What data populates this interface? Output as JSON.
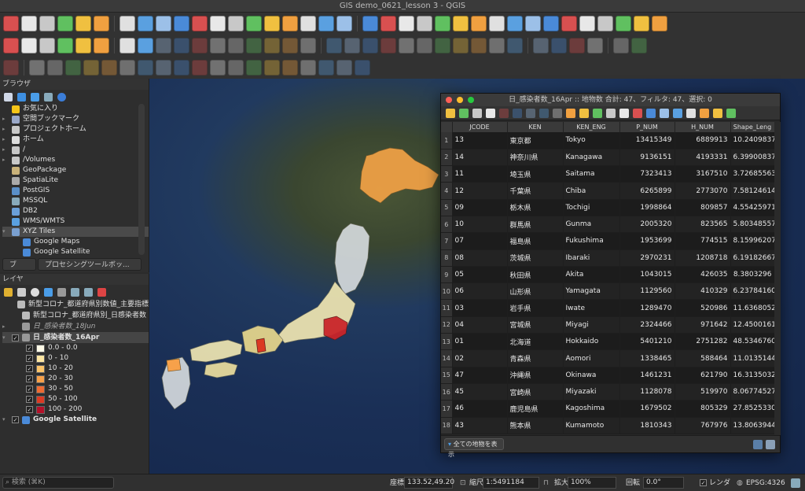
{
  "window": {
    "title": "GIS demo_0621_lesson 3 - QGIS"
  },
  "colors": {
    "accent": "#f0a040",
    "selection": "#4a4a4a",
    "close": "#ff5f56",
    "minimize": "#ffbd2e",
    "zoom": "#27c93f"
  },
  "browser": {
    "title": "ブラウザ",
    "items": [
      {
        "label": "お気に入り",
        "icon": "star-icon"
      },
      {
        "label": "空間ブックマーク",
        "icon": "bookmark-icon"
      },
      {
        "label": "プロジェクトホーム",
        "icon": "folder-icon"
      },
      {
        "label": "ホーム",
        "icon": "home-icon"
      },
      {
        "label": "/",
        "icon": "folder-icon"
      },
      {
        "label": "/Volumes",
        "icon": "folder-icon"
      },
      {
        "label": "GeoPackage",
        "icon": "geopackage-icon"
      },
      {
        "label": "SpatiaLite",
        "icon": "spatialite-icon"
      },
      {
        "label": "PostGIS",
        "icon": "postgis-icon"
      },
      {
        "label": "MSSQL",
        "icon": "mssql-icon"
      },
      {
        "label": "DB2",
        "icon": "db2-icon"
      },
      {
        "label": "WMS/WMTS",
        "icon": "globe-icon"
      },
      {
        "label": "XYZ Tiles",
        "icon": "xyz-icon"
      },
      {
        "label": "Google Maps",
        "icon": "tile-icon"
      },
      {
        "label": "Google Satellite",
        "icon": "tile-icon"
      }
    ],
    "tabs": [
      "ブラ...",
      "プロセシングツールボッ..."
    ]
  },
  "layers": {
    "title": "レイヤ",
    "items": [
      {
        "label": "新型コロナ_都道府県別数値_主要指標",
        "italic": false
      },
      {
        "label": "新型コロナ_都道府県別_日感染者数",
        "italic": false
      },
      {
        "label": "日_感染者数_18Jun",
        "italic": true
      },
      {
        "label": "日_感染者数_16Apr",
        "italic": false
      }
    ],
    "legend": [
      {
        "label": "0.0 - 0.0",
        "color": "#fffbe8"
      },
      {
        "label": "0 - 10",
        "color": "#fde6a2"
      },
      {
        "label": "10 - 20",
        "color": "#fbc46a"
      },
      {
        "label": "20 - 30",
        "color": "#f7a14a"
      },
      {
        "label": "30 - 50",
        "color": "#ee6b32"
      },
      {
        "label": "50 - 100",
        "color": "#db3a22"
      },
      {
        "label": "100 - 200",
        "color": "#b41028"
      }
    ],
    "satellite": "Google Satellite"
  },
  "attribute_table": {
    "title": "日_感染者数_16Apr :: 地物数 合計: 47、フィルタ: 47、選択: 0",
    "columns": [
      "JCODE",
      "KEN",
      "KEN_ENG",
      "P_NUM",
      "H_NUM",
      "Shape_Leng"
    ],
    "rows": [
      [
        "1",
        "13",
        "東京都",
        "Tokyo",
        "13415349",
        "6889913",
        "10.2409837"
      ],
      [
        "2",
        "14",
        "神奈川県",
        "Kanagawa",
        "9136151",
        "4193331",
        "6.39900837"
      ],
      [
        "3",
        "11",
        "埼玉県",
        "Saitama",
        "7323413",
        "3167510",
        "3.72685563"
      ],
      [
        "4",
        "12",
        "千葉県",
        "Chiba",
        "6265899",
        "2773070",
        "7.58124614"
      ],
      [
        "5",
        "09",
        "栃木県",
        "Tochigi",
        "1998864",
        "809857",
        "4.55425971"
      ],
      [
        "6",
        "10",
        "群馬県",
        "Gunma",
        "2005320",
        "823565",
        "5.80348557"
      ],
      [
        "7",
        "07",
        "福島県",
        "Fukushima",
        "1953699",
        "774515",
        "8.15996207"
      ],
      [
        "8",
        "08",
        "茨城県",
        "Ibaraki",
        "2970231",
        "1208718",
        "6.19182667"
      ],
      [
        "9",
        "05",
        "秋田県",
        "Akita",
        "1043015",
        "426035",
        "8.3803296"
      ],
      [
        "10",
        "06",
        "山形県",
        "Yamagata",
        "1129560",
        "410329",
        "6.23784160"
      ],
      [
        "11",
        "03",
        "岩手県",
        "Iwate",
        "1289470",
        "520986",
        "11.6368052"
      ],
      [
        "12",
        "04",
        "宮城県",
        "Miyagi",
        "2324466",
        "971642",
        "12.4500161"
      ],
      [
        "13",
        "01",
        "北海道",
        "Hokkaido",
        "5401210",
        "2751282",
        "48.5346760"
      ],
      [
        "14",
        "02",
        "青森県",
        "Aomori",
        "1338465",
        "588464",
        "11.01351441"
      ],
      [
        "15",
        "47",
        "沖縄県",
        "Okinawa",
        "1461231",
        "621790",
        "16.3135032"
      ],
      [
        "16",
        "45",
        "宮崎県",
        "Miyazaki",
        "1128078",
        "519970",
        "8.06774527"
      ],
      [
        "17",
        "46",
        "鹿児島県",
        "Kagoshima",
        "1679502",
        "805329",
        "27.8525330"
      ],
      [
        "18",
        "43",
        "熊本県",
        "Kumamoto",
        "1810343",
        "767976",
        "13.8063944"
      ]
    ],
    "footer_button": "全ての地物を表示"
  },
  "status": {
    "search_placeholder": "検索 (⌘K)",
    "coord_label": "座標",
    "coord_value": "133.52,49.20",
    "scale_label": "縮尺",
    "scale_value": "1:5491184",
    "magnifier_label": "拡大",
    "magnifier_value": "100%",
    "rotation_label": "回転",
    "rotation_value": "0.0°",
    "render_label": "レンダ",
    "crs": "EPSG:4326"
  }
}
